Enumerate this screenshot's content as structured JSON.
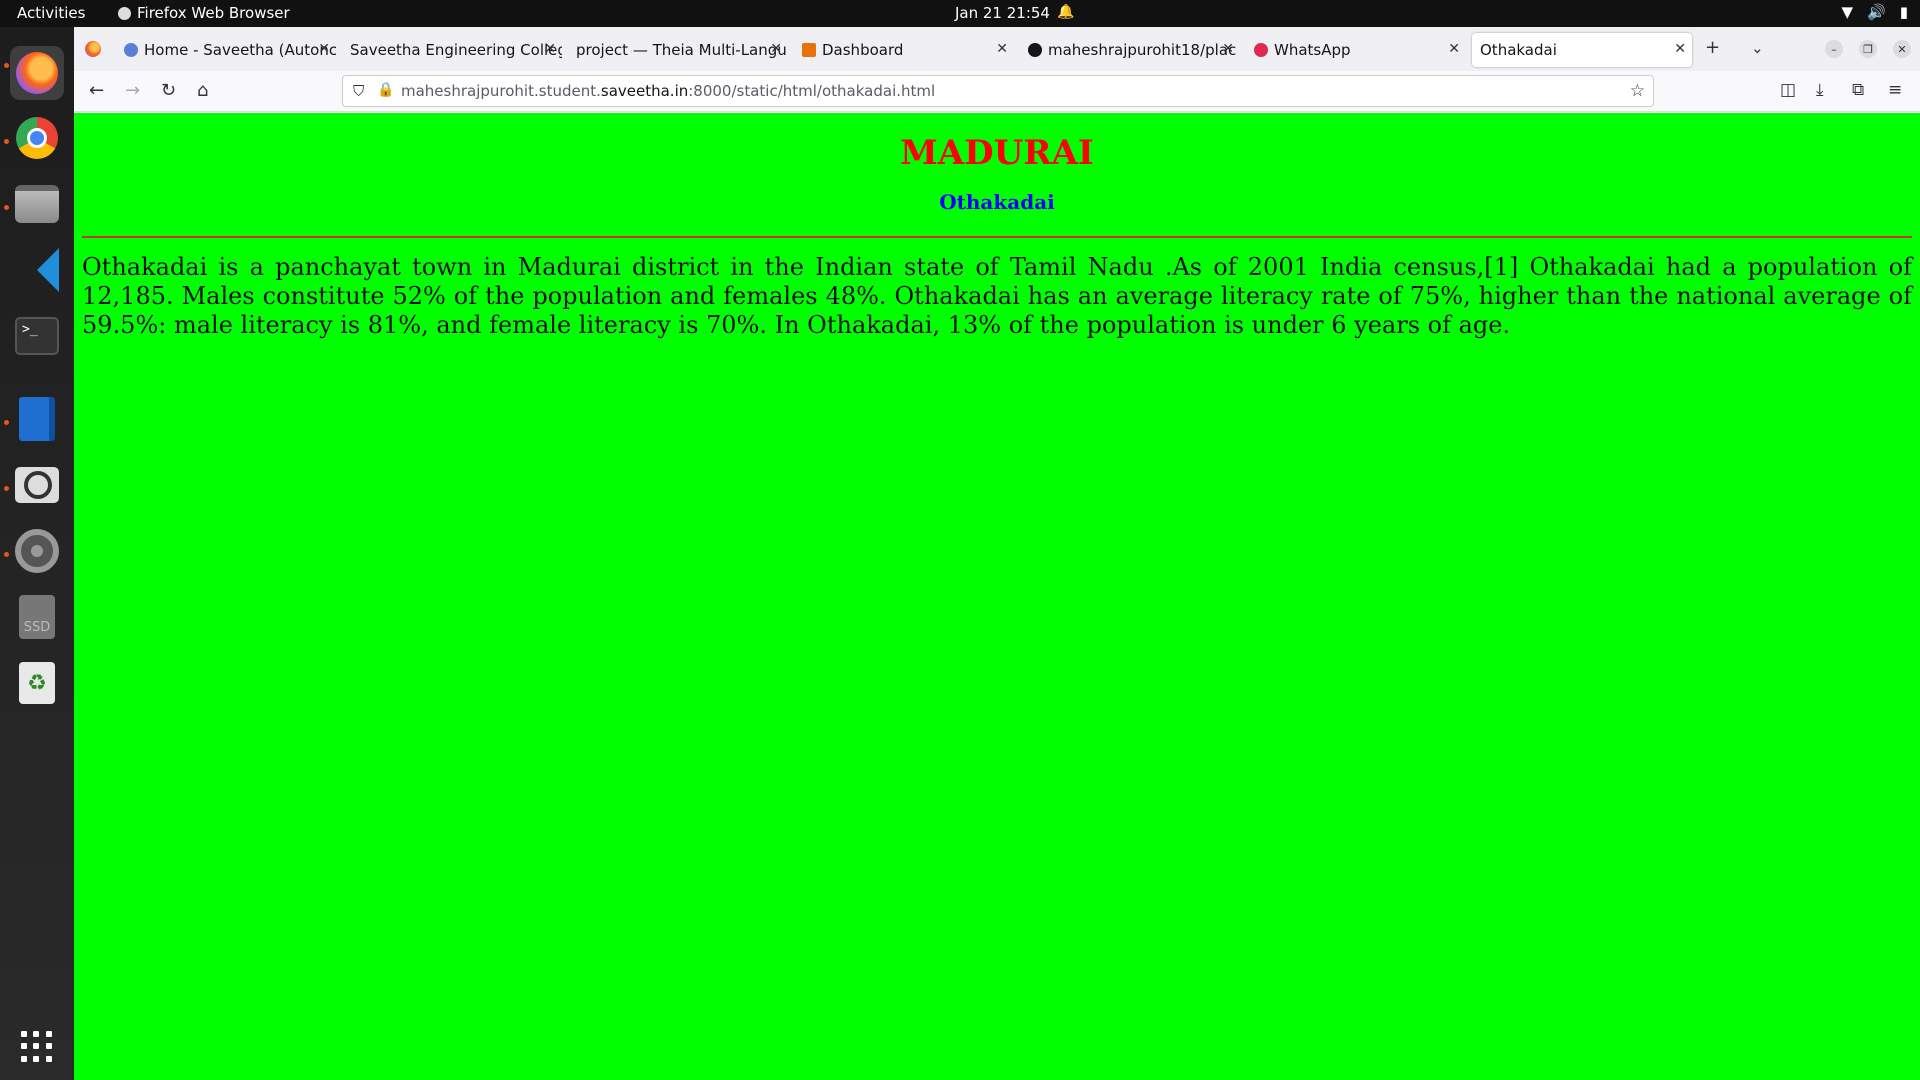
{
  "topbar": {
    "activities": "Activities",
    "app_name": "Firefox Web Browser",
    "clock": "Jan 21  21:54"
  },
  "dock": {
    "items": [
      "firefox-icon",
      "chrome-icon",
      "files-icon",
      "vscode-icon",
      "terminal-icon",
      "writer-icon",
      "search-icon",
      "settings-icon",
      "ssd-icon",
      "trash-icon",
      "apps-grid-icon"
    ],
    "ssd_label": "SSD"
  },
  "tabs": [
    {
      "title": "Home - Saveetha (Autonc",
      "favicon_color": "#5a7fd6"
    },
    {
      "title": "Saveetha Engineering Colleg",
      "favicon_color": ""
    },
    {
      "title": "project — Theia Multi-Langu",
      "favicon_color": ""
    },
    {
      "title": "Dashboard",
      "favicon_color": "#e8710a"
    },
    {
      "title": "maheshrajpurohit18/plac",
      "favicon_color": "#15141a"
    },
    {
      "title": "WhatsApp",
      "favicon_color": "#e22850"
    },
    {
      "title": "Othakadai",
      "favicon_color": "",
      "active": true
    }
  ],
  "urlbar": {
    "prefix": "maheshrajpurohit.student.",
    "host": "saveetha.in",
    "suffix": ":8000/static/html/othakadai.html"
  },
  "page": {
    "heading": "MADURAI",
    "subheading": "Othakadai",
    "paragraph": "Othakadai is a panchayat town in Madurai district in the Indian state of Tamil Nadu .As of 2001 India census,[1] Othakadai had a population of 12,185. Males constitute 52% of the population and females 48%. Othakadai has an average literacy rate of 75%, higher than the national average of 59.5%: male literacy is 81%, and female literacy is 70%. In Othakadai, 13% of the population is under 6 years of age.",
    "background_color": "#00ff00",
    "heading_color": "#ff0000",
    "subheading_color": "#0000ff"
  }
}
